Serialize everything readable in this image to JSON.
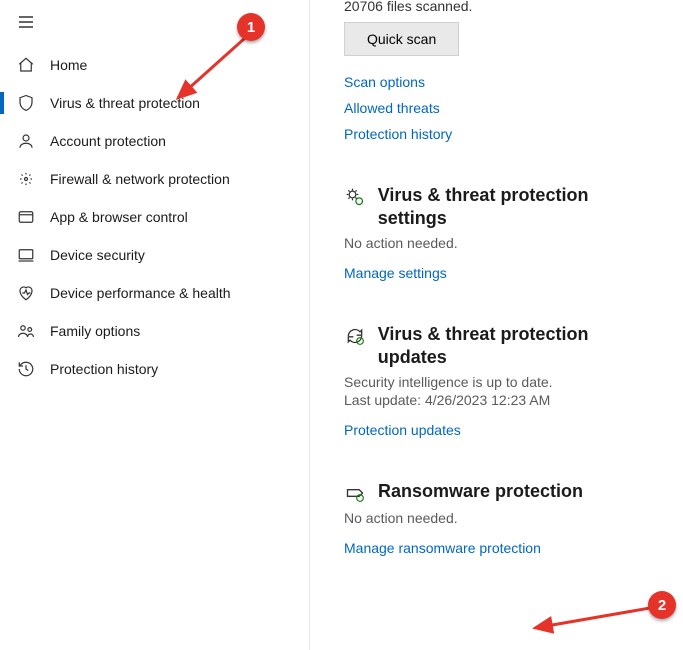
{
  "sidebar": {
    "items": [
      {
        "label": "Home",
        "icon": "home-icon",
        "selected": false
      },
      {
        "label": "Virus & threat protection",
        "icon": "shield-icon",
        "selected": true
      },
      {
        "label": "Account protection",
        "icon": "account-icon",
        "selected": false
      },
      {
        "label": "Firewall & network protection",
        "icon": "firewall-icon",
        "selected": false
      },
      {
        "label": "App & browser control",
        "icon": "browser-icon",
        "selected": false
      },
      {
        "label": "Device security",
        "icon": "device-icon",
        "selected": false
      },
      {
        "label": "Device performance & health",
        "icon": "health-icon",
        "selected": false
      },
      {
        "label": "Family options",
        "icon": "family-icon",
        "selected": false
      },
      {
        "label": "Protection history",
        "icon": "history-icon",
        "selected": false
      }
    ]
  },
  "scan": {
    "status": "20706 files scanned.",
    "button": "Quick scan",
    "links": {
      "options": "Scan options",
      "allowed": "Allowed threats",
      "history": "Protection history"
    }
  },
  "settings_section": {
    "title": "Virus & threat protection settings",
    "status": "No action needed.",
    "link": "Manage settings"
  },
  "updates_section": {
    "title": "Virus & threat protection updates",
    "status": "Security intelligence is up to date.",
    "last_update": "Last update: 4/26/2023 12:23 AM",
    "link": "Protection updates"
  },
  "ransomware_section": {
    "title": "Ransomware protection",
    "status": "No action needed.",
    "link": "Manage ransomware protection"
  },
  "annotations": {
    "badge1": "1",
    "badge2": "2"
  }
}
